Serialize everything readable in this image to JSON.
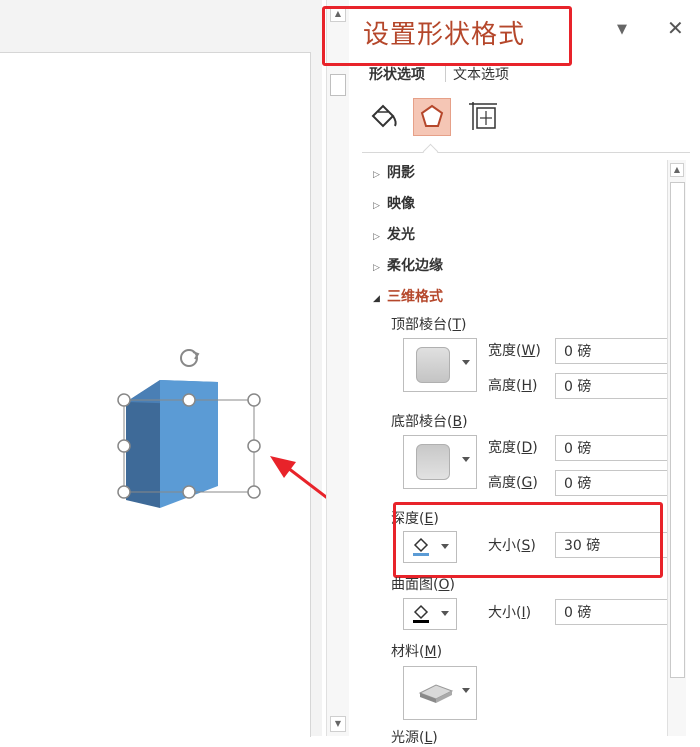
{
  "pane": {
    "title": "设置形状格式",
    "tabs": {
      "shape": "形状选项",
      "text": "文本选项"
    },
    "sections": {
      "shadow": "阴影",
      "reflection": "映像",
      "glow": "发光",
      "soft_edges": "柔化边缘",
      "format_3d": "三维格式"
    },
    "format_3d": {
      "top_bevel": {
        "label": "顶部棱台",
        "key": "T",
        "width_label": "宽度",
        "width_key": "W",
        "width_value": "0 磅",
        "height_label": "高度",
        "height_key": "H",
        "height_value": "0 磅"
      },
      "bottom_bevel": {
        "label": "底部棱台",
        "key": "B",
        "width_label": "宽度",
        "width_key": "D",
        "width_value": "0 磅",
        "height_label": "高度",
        "height_key": "G",
        "height_value": "0 磅"
      },
      "depth": {
        "label": "深度",
        "key": "E",
        "size_label": "大小",
        "size_key": "S",
        "size_value": "30 磅",
        "color": "#5b9bd5"
      },
      "contour": {
        "label": "曲面图",
        "key": "O",
        "size_label": "大小",
        "size_key": "I",
        "size_value": "0 磅",
        "color": "#000000"
      },
      "material": {
        "label": "材料",
        "key": "M"
      },
      "lighting": {
        "label": "光源",
        "key": "L"
      }
    }
  },
  "colors": {
    "accent": "#b5472b",
    "highlight": "#e8232a",
    "shape_front": "#5b9bd5",
    "shape_side": "#3e6a98",
    "shape_top": "#4a7fb5"
  }
}
